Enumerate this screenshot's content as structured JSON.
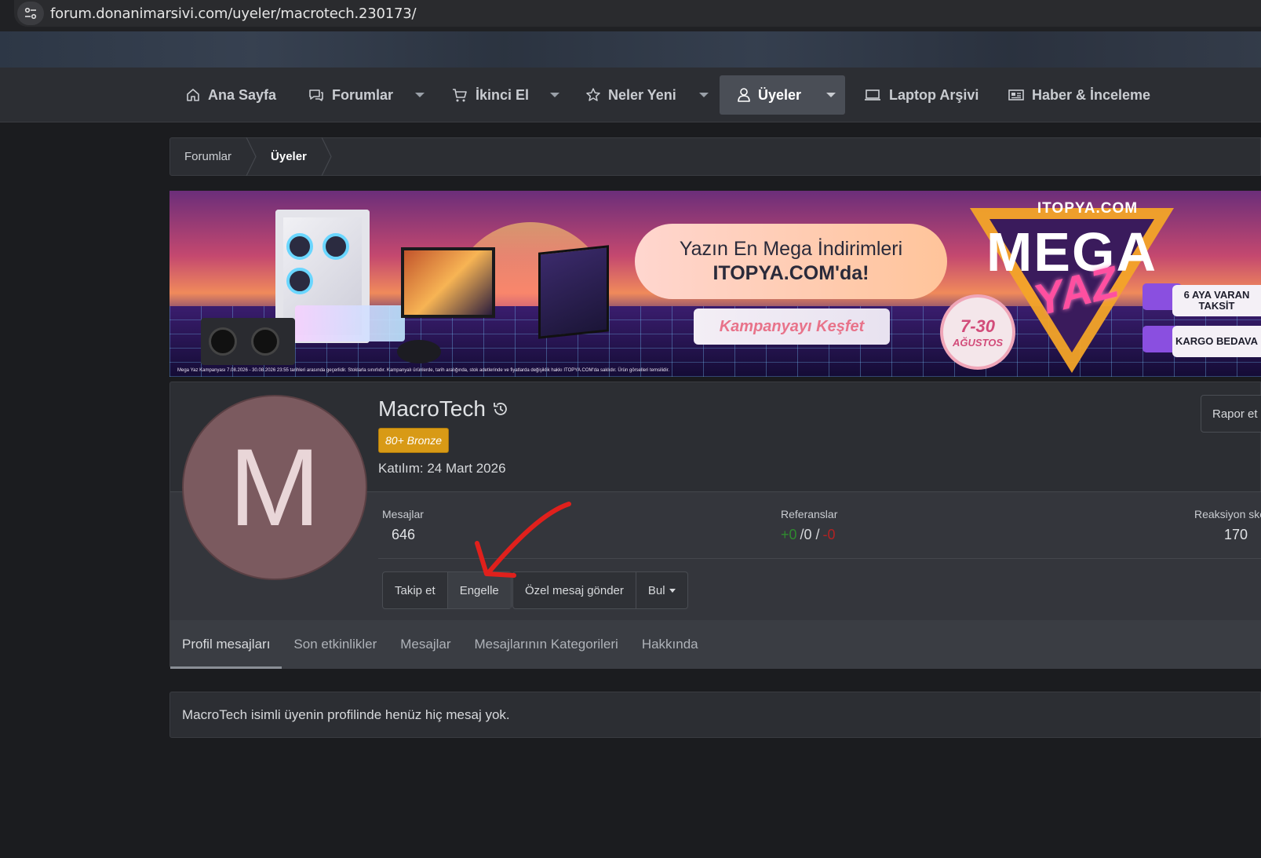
{
  "browser": {
    "url": "forum.donanimarsivi.com/uyeler/macrotech.230173/"
  },
  "nav": {
    "items": [
      {
        "label": "Ana Sayfa",
        "icon": "home-icon"
      },
      {
        "label": "Forumlar",
        "icon": "chat-icon"
      },
      {
        "label": "İkinci El",
        "icon": "cart-icon"
      },
      {
        "label": "Neler Yeni",
        "icon": "star-icon"
      },
      {
        "label": "Üyeler",
        "icon": "user-icon",
        "active": true
      },
      {
        "label": "Laptop Arşivi",
        "icon": "laptop-icon"
      },
      {
        "label": "Haber & İnceleme",
        "icon": "newspaper-icon"
      }
    ]
  },
  "breadcrumb": {
    "items": [
      "Forumlar",
      "Üyeler"
    ]
  },
  "banner": {
    "headline_1": "Yazın En Mega İndirimleri",
    "headline_2": "ITOPYA.COM'da!",
    "cta": "Kampanyayı Keşfet",
    "date_1": "7-30",
    "date_2": "AĞUSTOS",
    "brand": "ITOPYA.COM",
    "mega": "MEGA",
    "yaz": "YAZ",
    "badge_installments": "6 AYA VARAN TAKSİT",
    "badge_shipping": "KARGO BEDAVA",
    "disclaimer": "Mega Yaz Kampanyası 7.08.2026 - 30.08.2026 23:55 tarihleri arasında geçerlidir. Stoklarla sınırlıdır. Kampanyalı ürünlerde, tarih aralığında, stok adetlerinde ve fiyatlarda değişiklik hakkı ITOPYA.COM'da saklıdır. Ürün görselleri temsilidir."
  },
  "profile": {
    "avatar_letter": "M",
    "username": "MacroTech",
    "rank": "80+ Bronze",
    "joined": "Katılım: 24 Mart 2026",
    "report": "Rapor et",
    "stats": {
      "messages_label": "Mesajlar",
      "messages_value": "646",
      "references_label": "Referanslar",
      "ref_positive": "+0",
      "ref_neutral": "/0 /",
      "ref_negative": "-0",
      "reaction_label": "Reaksiyon skoru",
      "reaction_value": "170"
    },
    "actions": {
      "follow": "Takip et",
      "block": "Engelle",
      "message": "Özel mesaj gönder",
      "find": "Bul"
    },
    "tabs": [
      "Profil mesajları",
      "Son etkinlikler",
      "Mesajlar",
      "Mesajlarının Kategorileri",
      "Hakkında"
    ]
  },
  "empty_message": "MacroTech isimli üyenin profilinde henüz hiç mesaj yok.",
  "colors": {
    "annotation_arrow": "#e0201c",
    "rank_badge": "#d89a16",
    "ref_positive": "#2f8a2f",
    "ref_negative": "#b22222"
  }
}
